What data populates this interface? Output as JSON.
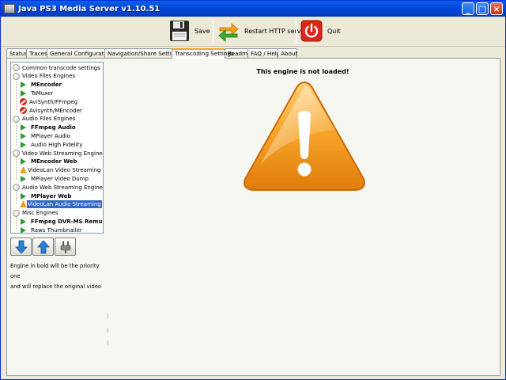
{
  "window": {
    "title": "Java PS3 Media Server v1.10.51",
    "minimize_glyph": "_",
    "maximize_glyph": "□",
    "close_glyph": "×"
  },
  "toolbar": {
    "save_label": "Save",
    "restart_label": "Restart HTTP server",
    "quit_label": "Quit"
  },
  "tabs": [
    {
      "label": "Status"
    },
    {
      "label": "Traces"
    },
    {
      "label": "General Configuration"
    },
    {
      "label": "Navigation/Share Settings"
    },
    {
      "label": "Transcoding Settings",
      "active": true
    },
    {
      "label": "Readme"
    },
    {
      "label": "FAQ / Help"
    },
    {
      "label": "About"
    }
  ],
  "tree": [
    {
      "label": "Common transcode settings",
      "icon": "folder-icon",
      "level": 0
    },
    {
      "label": "Video Files Engines",
      "icon": "folder-icon",
      "level": 0
    },
    {
      "label": "MEncoder",
      "icon": "play-icon",
      "level": 1,
      "bold": true
    },
    {
      "label": "TsMuxer",
      "icon": "play-icon",
      "level": 1
    },
    {
      "label": "AviSynth/FFmpeg",
      "icon": "forbidden-icon",
      "level": 1
    },
    {
      "label": "Avisynth/MEncoder",
      "icon": "forbidden-icon",
      "level": 1
    },
    {
      "label": "Audio Files Engines",
      "icon": "folder-icon",
      "level": 0
    },
    {
      "label": "FFmpeg Audio",
      "icon": "play-icon",
      "level": 1,
      "bold": true
    },
    {
      "label": "MPlayer Audio",
      "icon": "play-icon",
      "level": 1
    },
    {
      "label": "Audio High Fidelity",
      "icon": "play-icon",
      "level": 1
    },
    {
      "label": "Video Web Streaming Engines",
      "icon": "folder-icon",
      "level": 0
    },
    {
      "label": "MEncoder Web",
      "icon": "play-icon",
      "level": 1,
      "bold": true
    },
    {
      "label": "VideoLan Video Streaming",
      "icon": "warning-icon",
      "level": 1
    },
    {
      "label": "MPlayer Video Dump",
      "icon": "play-icon",
      "level": 1
    },
    {
      "label": "Audio Web Streaming Engines",
      "icon": "folder-icon",
      "level": 0
    },
    {
      "label": "MPlayer Web",
      "icon": "play-icon",
      "level": 1,
      "bold": true
    },
    {
      "label": "VideoLan Audio Streaming",
      "icon": "warning-icon",
      "level": 1,
      "selected": true
    },
    {
      "label": "Misc Engines",
      "icon": "folder-icon",
      "level": 0
    },
    {
      "label": "FFmpeg DVR-MS Remux",
      "icon": "play-icon",
      "level": 1,
      "bold": true
    },
    {
      "label": "Raws Thumbnailer",
      "icon": "play-icon",
      "level": 1
    }
  ],
  "buttons": {
    "move_down_icon": "arrow-down-icon",
    "move_up_icon": "arrow-up-icon",
    "toggle_icon": "plug-icon"
  },
  "hint": {
    "line1": "Engine in bold will be the priority one",
    "line2": "and will replace the original video"
  },
  "main": {
    "status_text": "This engine is not loaded!",
    "warning_glyph": "!"
  },
  "colors": {
    "selection": "#316ac5",
    "warning_orange": "#f39a1c",
    "play_green": "#2e9a2e",
    "forbidden_red": "#d02a1a"
  }
}
